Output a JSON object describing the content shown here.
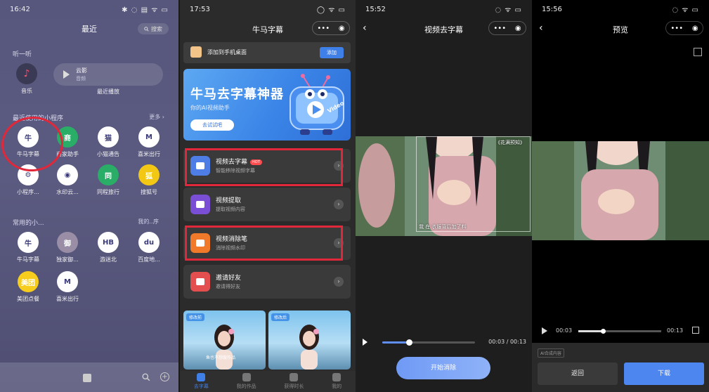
{
  "panel1": {
    "status_time": "16:42",
    "status_icons": "✱ ◌ ▤ ᯤ ▭",
    "title": "最近",
    "search_label": "搜索",
    "section_listen": "听一听",
    "music_label": "音乐",
    "recent_play": {
      "name": "云影",
      "source": "音频",
      "caption": "最近播放"
    },
    "section_recent_mini": "最近使用的小程序",
    "more_label": "更多",
    "recent_apps": [
      {
        "label": "牛马字幕",
        "color": "#ffffff",
        "glyph": "牛"
      },
      {
        "label": "商家助手",
        "color": "#2aae67",
        "glyph": "商"
      },
      {
        "label": "小猫通告",
        "color": "#ffffff",
        "glyph": "猫"
      },
      {
        "label": "喜米出行",
        "color": "#ffffff",
        "glyph": "M"
      },
      {
        "label": "小程序...",
        "color": "#ffffff",
        "glyph": "⚙"
      },
      {
        "label": "水印云...",
        "color": "#ffffff",
        "glyph": "◉"
      },
      {
        "label": "同程旅行",
        "color": "#2aae67",
        "glyph": "同"
      },
      {
        "label": "搜狐号",
        "color": "#f3c814",
        "glyph": "狐"
      }
    ],
    "section_common": "常用的小...",
    "common_more": "我的...",
    "common_sort": "序",
    "common_apps": [
      {
        "label": "牛马字幕",
        "color": "#ffffff",
        "glyph": "牛"
      },
      {
        "label": "独家御...",
        "color": "#9a8ea6",
        "glyph": "御"
      },
      {
        "label": "游迷北",
        "color": "#ffffff",
        "glyph": "HB"
      },
      {
        "label": "百度地...",
        "color": "#ffffff",
        "glyph": "du"
      },
      {
        "label": "美团点餐",
        "color": "#f7cd1d",
        "glyph": "美团"
      },
      {
        "label": "喜米出行",
        "color": "#ffffff",
        "glyph": "M"
      }
    ]
  },
  "panel2": {
    "status_time": "17:53",
    "status_icons": "◯ ᯤ ▭",
    "title": "牛马字幕",
    "capsule_more": "•••",
    "capsule_close": "◉",
    "add_text": "添加到手机桌面",
    "add_button": "添加",
    "banner_title": "牛马去字幕神器",
    "banner_sub": "你的AI视频助手",
    "banner_try": "去试试吧",
    "banner_badge": "Video",
    "menu": [
      {
        "title": "视频去字幕",
        "hot": "HOT",
        "sub": "智能移除视频字幕",
        "color": "#4f7de6"
      },
      {
        "title": "视频提取",
        "hot": "",
        "sub": "提取视频内容",
        "color": "#7a4fd6"
      },
      {
        "title": "视频消除笔",
        "hot": "",
        "sub": "消除视频水印",
        "color": "#f07a2a"
      },
      {
        "title": "邀请好友",
        "hot": "",
        "sub": "邀请得好友",
        "color": "#e34f4f"
      }
    ],
    "compare_before": "修改前",
    "compare_after": "修改后",
    "compare_caption": "鱼也不想做作品",
    "tabs": [
      {
        "label": "去字幕",
        "active": true
      },
      {
        "label": "我的作品",
        "active": false
      },
      {
        "label": "获得时长",
        "active": false
      },
      {
        "label": "我的",
        "active": false
      }
    ]
  },
  "panel3": {
    "status_time": "15:52",
    "status_icons": "◌ ᯤ ▭",
    "title": "视频去字幕",
    "video_tag": "《花满预知》",
    "subtitle_text": "我 在 衣服背后加了料",
    "progress": 0.29,
    "time": "00:03 / 00:13",
    "start_button": "开始消除"
  },
  "panel4": {
    "status_time": "15:56",
    "status_icons": "◌ ᯤ ▭",
    "title": "预览",
    "current": "00:03",
    "duration": "00:13",
    "progress": 0.3,
    "ai_tag": "AI合成内容",
    "back_button": "返回",
    "download_button": "下载"
  }
}
